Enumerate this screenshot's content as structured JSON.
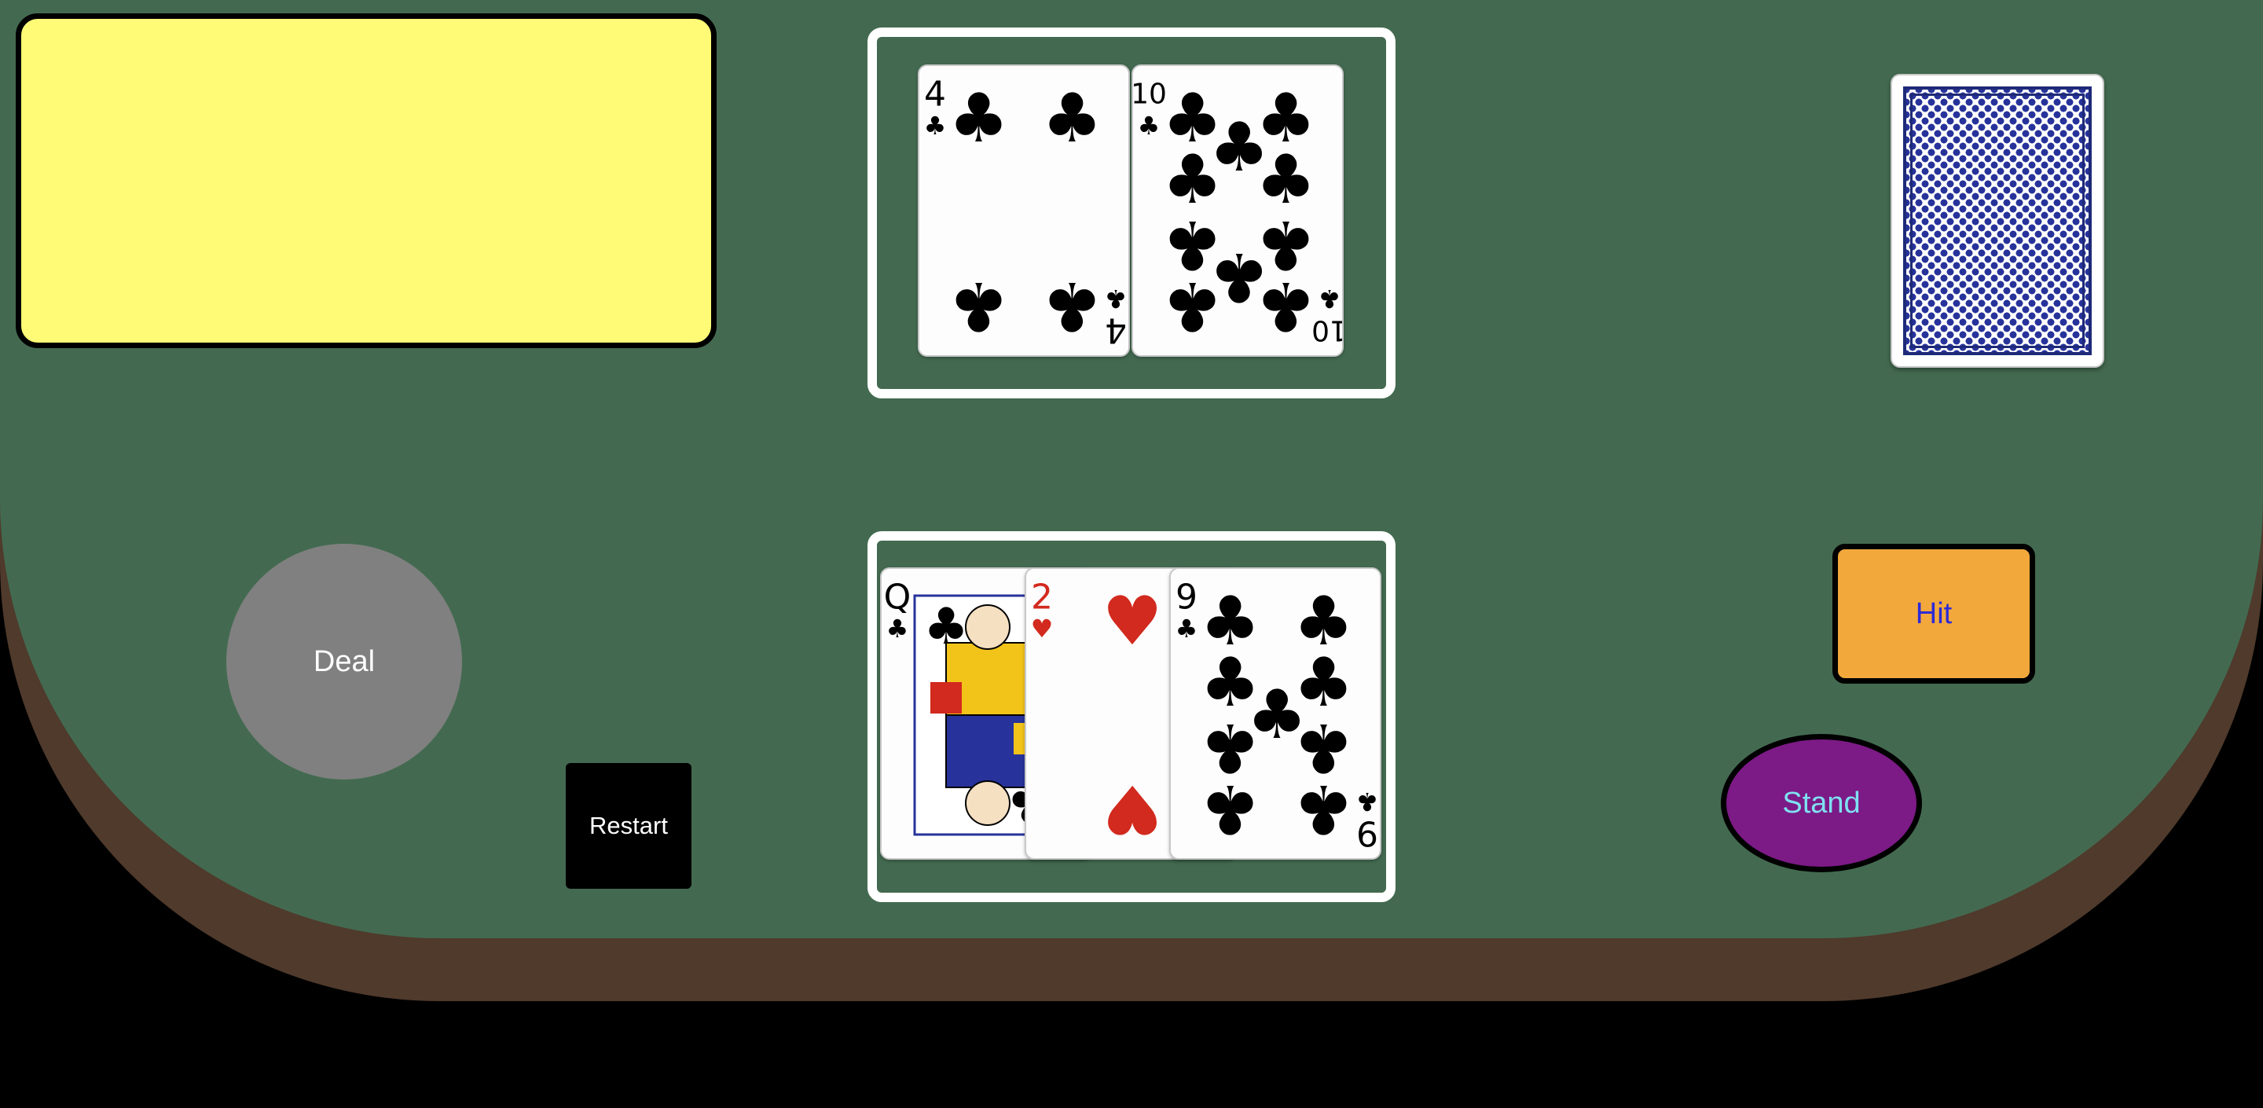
{
  "message": {
    "text": ""
  },
  "dealer_hand": {
    "cards": [
      {
        "rank": "4",
        "suit": "clubs",
        "symbol": "♣",
        "color": "#000000"
      },
      {
        "rank": "10",
        "suit": "clubs",
        "symbol": "♣",
        "color": "#000000"
      }
    ]
  },
  "player_hand": {
    "cards": [
      {
        "rank": "Q",
        "suit": "clubs",
        "symbol": "♣",
        "color": "#000000"
      },
      {
        "rank": "2",
        "suit": "hearts",
        "symbol": "♥",
        "color": "#d22a1e"
      },
      {
        "rank": "9",
        "suit": "clubs",
        "symbol": "♣",
        "color": "#000000"
      }
    ]
  },
  "deck": {
    "face": "down",
    "back_color": "#27339a"
  },
  "buttons": {
    "deal": "Deal",
    "restart": "Restart",
    "hit": "Hit",
    "stand": "Stand"
  },
  "colors": {
    "felt": "#436a50",
    "rim": "#4f3a2c",
    "message_bg": "#fffb76",
    "deal_bg": "#808080",
    "hit_bg": "#f3a83c",
    "hit_text": "#2d2ad6",
    "stand_bg": "#7c1a86",
    "stand_text": "#7fe0f0"
  }
}
